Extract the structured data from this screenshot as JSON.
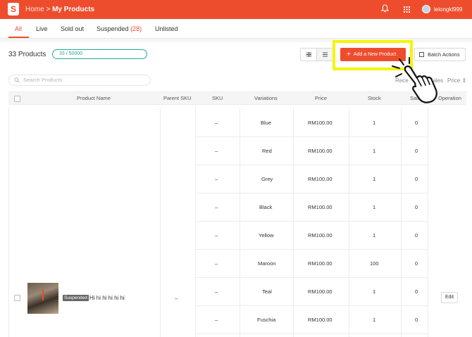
{
  "header": {
    "logo_letter": "S",
    "breadcrumb_home": "Home",
    "breadcrumb_sep": ">",
    "breadcrumb_current": "My Products",
    "username": "lelongkl999",
    "icons": [
      "notification-bell-icon",
      "apps-grid-icon"
    ]
  },
  "tabs": [
    {
      "label": "All",
      "count": ""
    },
    {
      "label": "Live",
      "count": ""
    },
    {
      "label": "Sold out",
      "count": ""
    },
    {
      "label": "Suspended",
      "count": "(28)"
    },
    {
      "label": "Unlisted",
      "count": ""
    }
  ],
  "toolbar": {
    "product_count": "33 Products",
    "quota": "33 / 50000",
    "add_label": "Add a New Product",
    "batch_label": "Batch Actions"
  },
  "search": {
    "placeholder": "Search Products"
  },
  "sort": {
    "recent": "Rece",
    "top_sales": "Top Sales",
    "price": "Price ⇕"
  },
  "table": {
    "headers": [
      "Product Name",
      "Parent SKU",
      "SKU",
      "Variations",
      "Price",
      "Stock",
      "Sales",
      "Operation"
    ],
    "product": {
      "status": "Suspended",
      "name": "Hi hi hi hi hi hi",
      "parent_sku": "–",
      "operation": "Edit"
    },
    "rows": [
      {
        "sku": "–",
        "variation": "Blue",
        "price": "RM100.00",
        "stock": "1",
        "sales": "0"
      },
      {
        "sku": "–",
        "variation": "Red",
        "price": "RM100.00",
        "stock": "1",
        "sales": "0"
      },
      {
        "sku": "–",
        "variation": "Grey",
        "price": "RM100.00",
        "stock": "1",
        "sales": "0"
      },
      {
        "sku": "–",
        "variation": "Black",
        "price": "RM100.00",
        "stock": "1",
        "sales": "0"
      },
      {
        "sku": "–",
        "variation": "Yellow",
        "price": "RM100.00",
        "stock": "1",
        "sales": "0"
      },
      {
        "sku": "–",
        "variation": "Maroon",
        "price": "RM100.00",
        "stock": "100",
        "sales": "0"
      },
      {
        "sku": "–",
        "variation": "Teal",
        "price": "RM100.00",
        "stock": "1",
        "sales": "0"
      },
      {
        "sku": "–",
        "variation": "Fuschia",
        "price": "RM100.00",
        "stock": "1",
        "sales": "0"
      }
    ]
  },
  "colors": {
    "brand": "#ee4d2d",
    "quota": "#26aa99",
    "highlight": "#f5f500"
  }
}
